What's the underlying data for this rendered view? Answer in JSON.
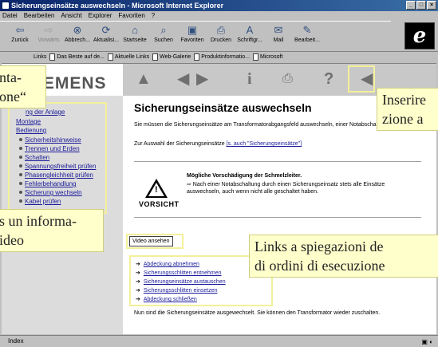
{
  "window": {
    "title": "Sicherungseinsätze auswechseln - Microsoft Internet Explorer"
  },
  "menu": [
    "Datei",
    "Bearbeiten",
    "Ansicht",
    "Explorer",
    "Favoriten",
    "?"
  ],
  "toolbar": [
    {
      "label": "Zurück",
      "icon": "back-arrow-icon"
    },
    {
      "label": "Vorwärts",
      "icon": "forward-arrow-icon"
    },
    {
      "label": "Abbrech...",
      "icon": "stop-icon"
    },
    {
      "label": "Aktualisi...",
      "icon": "refresh-icon"
    },
    {
      "label": "Startseite",
      "icon": "home-icon"
    },
    {
      "label": "Suchen",
      "icon": "search-icon"
    },
    {
      "label": "Favoriten",
      "icon": "favorites-icon"
    },
    {
      "label": "Drucken",
      "icon": "print-icon"
    },
    {
      "label": "Schriftgr...",
      "icon": "font-icon"
    },
    {
      "label": "Mail",
      "icon": "mail-icon"
    },
    {
      "label": "Bearbeit...",
      "icon": "edit-icon"
    }
  ],
  "links_bar": {
    "label": "Links",
    "items": [
      "Das Beste auf de...",
      "Aktuelle Links",
      "Web-Galerie",
      "Produktinformatio...",
      "Microsoft"
    ]
  },
  "logo": {
    "text": "SIEMENS"
  },
  "sidebar": {
    "items": [
      {
        "label": "Montage",
        "dot": false
      },
      {
        "label": "Bedienung",
        "dot": false
      },
      {
        "label": "Sicherheitshinweise",
        "dot": true
      },
      {
        "label": "Trennen und Erden",
        "dot": true
      },
      {
        "label": "Schalten",
        "dot": true
      },
      {
        "label": "Spannungsfreiheit prüfen",
        "dot": true
      },
      {
        "label": "Phasengleichheit prüfen",
        "dot": true
      },
      {
        "label": "Fehlerbehandlung",
        "dot": true
      },
      {
        "label": "Sicherung wechseln",
        "dot": true
      },
      {
        "label": "Kabel prüfen",
        "dot": true
      }
    ],
    "partial_top": "ng der Anlage"
  },
  "content": {
    "title": "Sicherungseinsätze auswechseln",
    "intro": "Sie müssen die Sicherungseinsätze am Transformatorabgangsfeld auswechseln, einer Notabschaltung.",
    "choose_prefix": "Zur Auswahl der Sicherungseinsätze",
    "choose_link": "[s. auch \"Sicherungseinsätze\"]",
    "warning_title": "Mögliche Vorschädigung der Schmelzleiter.",
    "warning_body": "⇨ Nach einer Notabschaltung durch einen Sicherungseinsatz stets alle Einsätze auswechseln, auch wenn nicht alle geschaltet haben.",
    "warning_label": "VORSICHT",
    "video_button": "Video ansehen",
    "steps": [
      "Abdeckung abnehmen",
      "Sicherungsschlitten entnehmen",
      "Sicherungseinsätze austauschen",
      "Sicherungsschlitten einsetzen",
      "Abdeckung schließen"
    ],
    "outro": "Nun sind die Sicherungseinsätze ausgewechselt. Sie können den Transformator wieder zuschalten."
  },
  "callouts": {
    "left_top": "nta-\none“",
    "right_top": "Inserire\nzione a",
    "left_mid": "s un informa-\nideo",
    "right_mid": "Links a spiegazioni de\ndi ordini di esecuzione"
  },
  "status": {
    "text": "Index"
  }
}
